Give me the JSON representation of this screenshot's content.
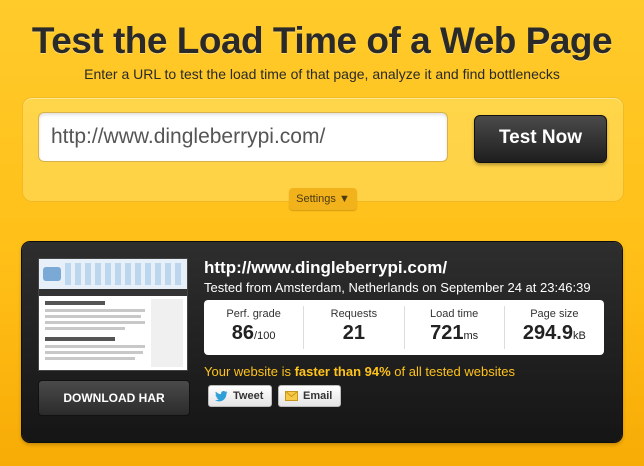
{
  "header": {
    "title": "Test the Load Time of a Web Page",
    "subtitle": "Enter a URL to test the load time of that page, analyze it and find bottlenecks"
  },
  "form": {
    "url_value": "http://www.dingleberrypi.com/",
    "test_button": "Test Now",
    "settings_button": "Settings ▼"
  },
  "result": {
    "url": "http://www.dingleberrypi.com/",
    "tested_from": "Tested from Amsterdam, Netherlands on September 24 at 23:46:39",
    "download_har": "DOWNLOAD HAR",
    "metrics": [
      {
        "label": "Perf. grade",
        "value": "86",
        "unit": "/100"
      },
      {
        "label": "Requests",
        "value": "21",
        "unit": ""
      },
      {
        "label": "Load time",
        "value": "721",
        "unit": "ms"
      },
      {
        "label": "Page size",
        "value": "294.9",
        "unit": "kB"
      }
    ],
    "verdict_prefix": "Your website is ",
    "verdict_bold": "faster than 94%",
    "verdict_suffix": " of all tested websites",
    "share": {
      "tweet": "Tweet",
      "email": "Email"
    }
  },
  "colors": {
    "accent_yellow": "#ffc31a",
    "background": "#ffbe16",
    "dark_panel": "#1e1e1e"
  },
  "icons": [
    "twitter-bird-icon",
    "email-envelope-icon"
  ]
}
